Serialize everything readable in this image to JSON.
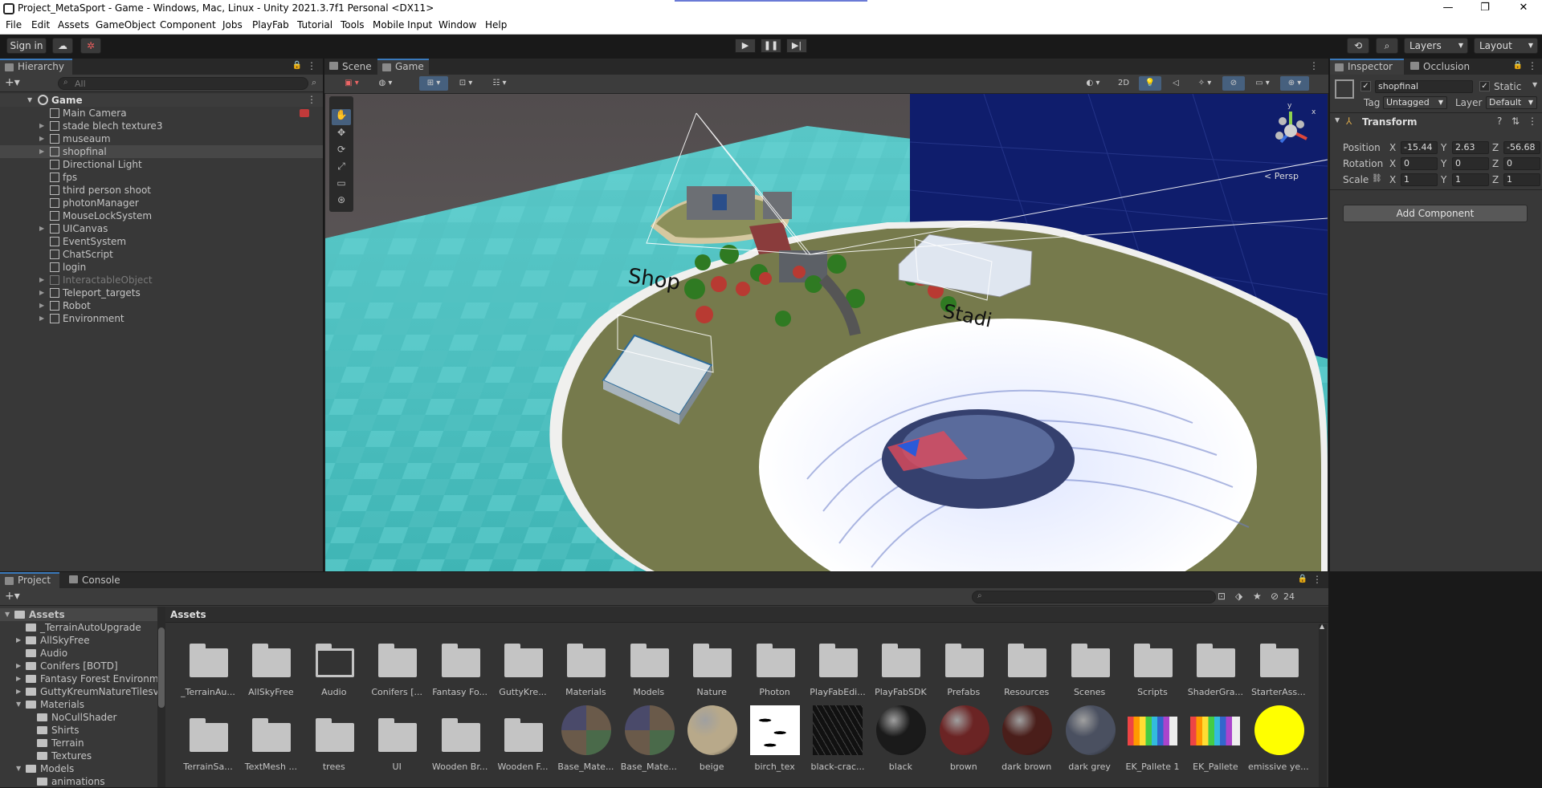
{
  "window": {
    "title": "Project_MetaSport - Game - Windows, Mac, Linux - Unity 2021.3.7f1 Personal <DX11>",
    "controls": [
      "—",
      "❐",
      "✕"
    ]
  },
  "menu": [
    "File",
    "Edit",
    "Assets",
    "GameObject",
    "Component",
    "Jobs",
    "PlayFab",
    "Tutorial",
    "Tools",
    "Mobile Input",
    "Window",
    "Help"
  ],
  "toolbar": {
    "sign_in": "Sign in",
    "layers": "Layers",
    "layout": "Layout"
  },
  "hierarchy": {
    "tab": "Hierarchy",
    "search_placeholder": "All",
    "scene_name": "Game",
    "items": [
      {
        "label": "Main Camera",
        "expandable": false,
        "disabled": false
      },
      {
        "label": "stade blech texture3",
        "expandable": true,
        "disabled": false
      },
      {
        "label": "museaum",
        "expandable": true,
        "disabled": false
      },
      {
        "label": "shopfinal",
        "expandable": true,
        "disabled": false
      },
      {
        "label": "Directional Light",
        "expandable": false,
        "disabled": false
      },
      {
        "label": "fps",
        "expandable": false,
        "disabled": false
      },
      {
        "label": "third person shoot",
        "expandable": false,
        "disabled": false
      },
      {
        "label": "photonManager",
        "expandable": false,
        "disabled": false
      },
      {
        "label": "MouseLockSystem",
        "expandable": false,
        "disabled": false
      },
      {
        "label": "UICanvas",
        "expandable": true,
        "disabled": false
      },
      {
        "label": "EventSystem",
        "expandable": false,
        "disabled": false
      },
      {
        "label": "ChatScript",
        "expandable": false,
        "disabled": false
      },
      {
        "label": "login",
        "expandable": false,
        "disabled": false
      },
      {
        "label": "InteractableObject",
        "expandable": true,
        "disabled": true
      },
      {
        "label": "Teleport_targets",
        "expandable": true,
        "disabled": false
      },
      {
        "label": "Robot",
        "expandable": true,
        "disabled": false
      },
      {
        "label": "Environment",
        "expandable": true,
        "disabled": false
      }
    ]
  },
  "scene_view": {
    "tabs": [
      "Scene",
      "Game"
    ],
    "mode_2d": "2D",
    "persp_label": "< Persp",
    "labels": {
      "shop": "Shop",
      "stadium": "Stadi"
    },
    "gizmo_axes": {
      "y": "y",
      "x": "x"
    }
  },
  "inspector": {
    "tabs": [
      "Inspector",
      "Occlusion"
    ],
    "object_name": "shopfinal",
    "static_label": "Static",
    "tag_label": "Tag",
    "tag_value": "Untagged",
    "layer_label": "Layer",
    "layer_value": "Default",
    "component": "Transform",
    "position": {
      "label": "Position",
      "x": "-15.44",
      "y": "2.63",
      "z": "-56.68"
    },
    "rotation": {
      "label": "Rotation",
      "x": "0",
      "y": "0",
      "z": "0"
    },
    "scale": {
      "label": "Scale",
      "x": "1",
      "y": "1",
      "z": "1"
    },
    "axis_x": "X",
    "axis_y": "Y",
    "axis_z": "Z",
    "add_component": "Add Component"
  },
  "project": {
    "tabs": [
      "Project",
      "Console"
    ],
    "breadcrumb": "Assets",
    "hidden_count": "24",
    "tree": [
      {
        "label": "Assets",
        "depth": 0,
        "arrow": "▼",
        "bold": true
      },
      {
        "label": "_TerrainAutoUpgrade",
        "depth": 1,
        "arrow": ""
      },
      {
        "label": "AllSkyFree",
        "depth": 1,
        "arrow": "▶"
      },
      {
        "label": "Audio",
        "depth": 1,
        "arrow": ""
      },
      {
        "label": "Conifers [BOTD]",
        "depth": 1,
        "arrow": "▶"
      },
      {
        "label": "Fantasy Forest Environme",
        "depth": 1,
        "arrow": "▶"
      },
      {
        "label": "GuttyKreumNatureTilesvo",
        "depth": 1,
        "arrow": "▶"
      },
      {
        "label": "Materials",
        "depth": 1,
        "arrow": "▼"
      },
      {
        "label": "NoCullShader",
        "depth": 2,
        "arrow": ""
      },
      {
        "label": "Shirts",
        "depth": 2,
        "arrow": ""
      },
      {
        "label": "Terrain",
        "depth": 2,
        "arrow": ""
      },
      {
        "label": "Textures",
        "depth": 2,
        "arrow": ""
      },
      {
        "label": "Models",
        "depth": 1,
        "arrow": "▼"
      },
      {
        "label": "animations",
        "depth": 2,
        "arrow": ""
      }
    ],
    "assets_row1": [
      {
        "label": "_TerrainAu...",
        "kind": "folder"
      },
      {
        "label": "AllSkyFree",
        "kind": "folder"
      },
      {
        "label": "Audio",
        "kind": "folder-empty"
      },
      {
        "label": "Conifers [...",
        "kind": "folder"
      },
      {
        "label": "Fantasy Fo...",
        "kind": "folder"
      },
      {
        "label": "GuttyKre...",
        "kind": "folder"
      },
      {
        "label": "Materials",
        "kind": "folder"
      },
      {
        "label": "Models",
        "kind": "folder"
      },
      {
        "label": "Nature",
        "kind": "folder"
      },
      {
        "label": "Photon",
        "kind": "folder"
      },
      {
        "label": "PlayFabEdi...",
        "kind": "folder"
      },
      {
        "label": "PlayFabSDK",
        "kind": "folder"
      },
      {
        "label": "Prefabs",
        "kind": "folder"
      },
      {
        "label": "Resources",
        "kind": "folder"
      },
      {
        "label": "Scenes",
        "kind": "folder"
      },
      {
        "label": "Scripts",
        "kind": "folder"
      },
      {
        "label": "ShaderGra...",
        "kind": "folder"
      },
      {
        "label": "StarterAss...",
        "kind": "folder"
      }
    ],
    "assets_row2": [
      {
        "label": "TerrainSa...",
        "kind": "folder"
      },
      {
        "label": "TextMesh ...",
        "kind": "folder"
      },
      {
        "label": "trees",
        "kind": "folder"
      },
      {
        "label": "UI",
        "kind": "folder"
      },
      {
        "label": "Wooden Br...",
        "kind": "folder"
      },
      {
        "label": "Wooden F...",
        "kind": "folder"
      },
      {
        "label": "Base_Mate...",
        "kind": "sphere-checker"
      },
      {
        "label": "Base_Mate...",
        "kind": "sphere-checker"
      },
      {
        "label": "beige",
        "kind": "sphere",
        "color": "#b8a98a"
      },
      {
        "label": "birch_tex",
        "kind": "tex-birch"
      },
      {
        "label": "black-crac...",
        "kind": "tex-black"
      },
      {
        "label": "black",
        "kind": "sphere",
        "color": "#1a1a1a"
      },
      {
        "label": "brown",
        "kind": "sphere",
        "color": "#6b2424"
      },
      {
        "label": "dark brown",
        "kind": "sphere",
        "color": "#4a1e1a"
      },
      {
        "label": "dark grey",
        "kind": "sphere",
        "color": "#4a5060"
      },
      {
        "label": "EK_Pallete 1",
        "kind": "tex-palette"
      },
      {
        "label": "EK_Pallete",
        "kind": "tex-palette"
      },
      {
        "label": "emissive ye...",
        "kind": "sphere",
        "color": "#ffff00"
      }
    ]
  },
  "colors": {
    "accent": "#3a79bb",
    "ocean": "#5ec9c9",
    "island": "#6f7448",
    "selection": "#2c5d87",
    "sky_panel": "#0d1c6b"
  }
}
